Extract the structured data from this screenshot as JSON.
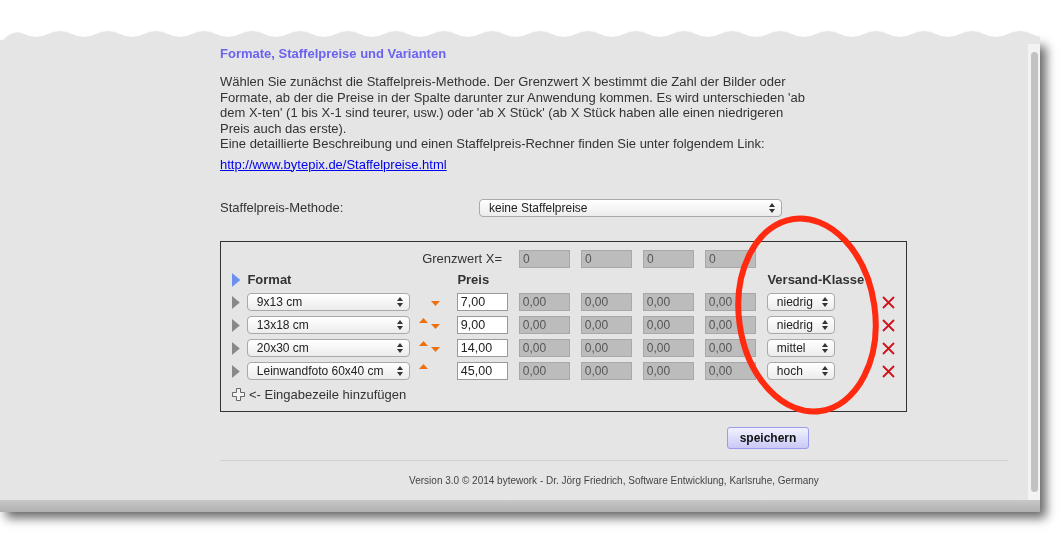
{
  "section_title": "Formate, Staffelpreise und Varianten",
  "intro": "Wählen Sie zunächst die Staffelpreis-Methode. Der Grenzwert X bestimmt die Zahl der Bilder oder Formate, ab der die Preise in der Spalte darunter zur Anwendung kommen. Es wird unterschieden 'ab dem X-ten' (1 bis X-1 sind teurer, usw.) oder 'ab X Stück' (ab X Stück haben alle einen niedrigeren Preis auch das erste).",
  "link_intro": "Eine detaillierte Beschreibung und einen Staffelpreis-Rechner finden Sie unter folgendem Link:",
  "link": "http://www.bytepix.de/Staffelpreise.html",
  "method": {
    "label": "Staffelpreis-Methode:",
    "value": "keine Staffelpreise"
  },
  "table": {
    "threshold_label": "Grenzwert X=",
    "thresholds": [
      "0",
      "0",
      "0",
      "0"
    ],
    "columns": {
      "format": "Format",
      "price": "Preis",
      "shipping": "Versand-Klasse"
    },
    "rows": [
      {
        "format": "9x13 cm",
        "can_move_up": false,
        "can_move_down": true,
        "price": "7,00",
        "tier_prices": [
          "0,00",
          "0,00",
          "0,00",
          "0,00"
        ],
        "shipping": "niedrig"
      },
      {
        "format": "13x18 cm",
        "can_move_up": true,
        "can_move_down": true,
        "price": "9,00",
        "tier_prices": [
          "0,00",
          "0,00",
          "0,00",
          "0,00"
        ],
        "shipping": "niedrig"
      },
      {
        "format": "20x30 cm",
        "can_move_up": true,
        "can_move_down": true,
        "price": "14,00",
        "tier_prices": [
          "0,00",
          "0,00",
          "0,00",
          "0,00"
        ],
        "shipping": "mittel"
      },
      {
        "format": "Leinwandfoto 60x40 cm",
        "can_move_up": true,
        "can_move_down": false,
        "price": "45,00",
        "tier_prices": [
          "0,00",
          "0,00",
          "0,00",
          "0,00"
        ],
        "shipping": "hoch"
      }
    ],
    "add_row": "<- Eingabezeile hinzufügen"
  },
  "save_button": "speichern",
  "footer": "Version 3.0 © 2014 bytework - Dr. Jörg Friedrich, Software Entwicklung, Karlsruhe, Germany"
}
